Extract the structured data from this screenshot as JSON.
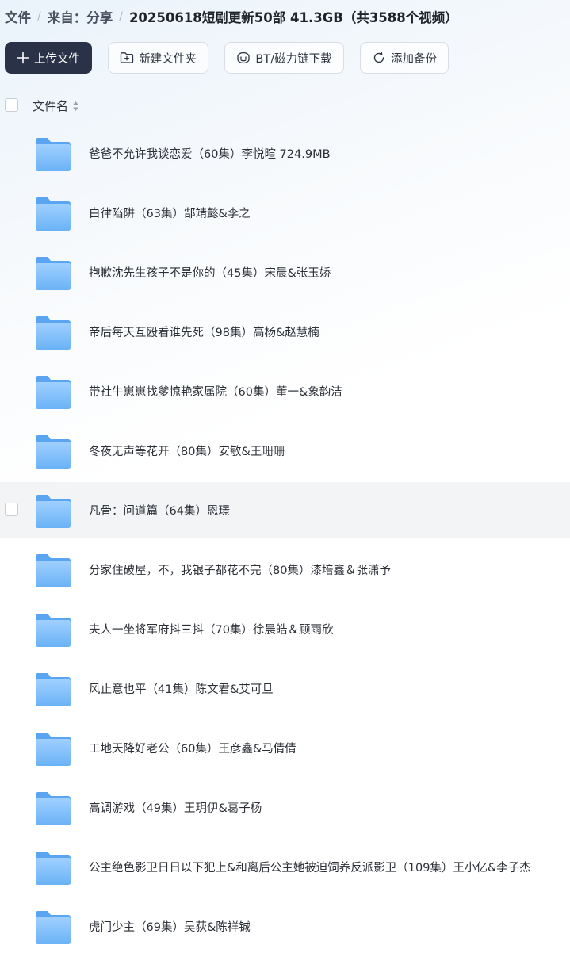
{
  "breadcrumb": {
    "items": [
      "文件",
      "来自：分享"
    ],
    "separator": "/",
    "current": "20250618短剧更新50部 41.3GB（共3588个视频）"
  },
  "toolbar": {
    "upload_label": "上传文件",
    "new_folder_label": "新建文件夹",
    "bt_label": "BT/磁力链下载",
    "backup_label": "添加备份"
  },
  "list_header": {
    "name_column": "文件名"
  },
  "files": [
    {
      "name": "爸爸不允许我谈恋爱（60集）李悦暄 724.9MB"
    },
    {
      "name": "白律陷阱（63集）郜靖懿&李之"
    },
    {
      "name": "抱歉沈先生孩子不是你的（45集）宋晨&张玉娇"
    },
    {
      "name": "帝后每天互殴看谁先死（98集）高杨&赵慧楠"
    },
    {
      "name": "带社牛崽崽找爹惊艳家属院（60集）董一&象韵洁"
    },
    {
      "name": "冬夜无声等花开（80集）安敏&王珊珊"
    },
    {
      "name": "凡骨：问道篇（64集）恩璟"
    },
    {
      "name": "分家住破屋，不，我银子都花不完（80集）漆培鑫＆张潇予"
    },
    {
      "name": "夫人一坐将军府抖三抖（70集）徐晨皓＆顾雨欣"
    },
    {
      "name": "风止意也平（41集）陈文君&艾可旦"
    },
    {
      "name": "工地天降好老公（60集）王彦鑫&马倩倩"
    },
    {
      "name": "高调游戏（49集）王玥伊&葛子杨"
    },
    {
      "name": "公主绝色影卫日日以下犯上&和离后公主她被迫饲养反派影卫（109集）王小亿&李子杰"
    },
    {
      "name": "虎门少主（69集）吴荻&陈祥铖"
    }
  ],
  "hovered_row_index": 6,
  "colors": {
    "primary_button": "#2a3247",
    "folder_light": "#8ec5fb",
    "folder_dark": "#5aa5f2",
    "hover_row": "#f3f4f6"
  }
}
